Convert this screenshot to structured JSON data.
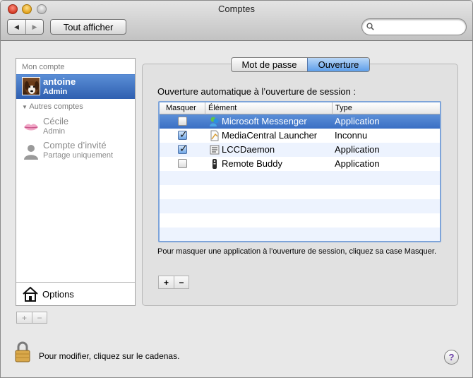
{
  "window": {
    "title": "Comptes",
    "show_all_label": "Tout afficher",
    "nav_back": "◀",
    "nav_forward": "▶",
    "search_placeholder": ""
  },
  "accounts": {
    "my_account_header": "Mon compte",
    "other_accounts_header": "Autres comptes",
    "disclosure": "▼",
    "items": [
      {
        "name": "antoine",
        "role": "Admin",
        "selected": true
      },
      {
        "name": "Cécile",
        "role": "Admin",
        "selected": false
      },
      {
        "name": "Compte d’invité",
        "role": "Partage uniquement",
        "selected": false
      }
    ],
    "options_label": "Options",
    "add": "+",
    "remove": "−"
  },
  "tabs": [
    {
      "label": "Mot de passe",
      "active": false
    },
    {
      "label": "Ouverture",
      "active": true
    }
  ],
  "login_items": {
    "section_label": "Ouverture automatique à l’ouverture de session :",
    "columns": [
      "Masquer",
      "Élément",
      "Type"
    ],
    "rows": [
      {
        "hide": false,
        "name": "Microsoft Messenger",
        "type": "Application",
        "icon": "messenger-icon",
        "selected": true
      },
      {
        "hide": true,
        "name": "MediaCentral Launcher",
        "type": "Inconnu",
        "icon": "document-icon",
        "selected": false
      },
      {
        "hide": true,
        "name": "LCCDaemon",
        "type": "Application",
        "icon": "daemon-icon",
        "selected": false
      },
      {
        "hide": false,
        "name": "Remote Buddy",
        "type": "Application",
        "icon": "remote-buddy-icon",
        "selected": false
      }
    ],
    "check_mark": "✓",
    "hint": "Pour masquer une application à l’ouverture de session, cliquez sa case Masquer.",
    "add": "+",
    "remove": "−"
  },
  "footer": {
    "lock_text": "Pour modifier, cliquez sur le cadenas.",
    "help": "?"
  },
  "colors": {
    "selection": "#3a6fc4",
    "accent": "#5d9ee9"
  }
}
